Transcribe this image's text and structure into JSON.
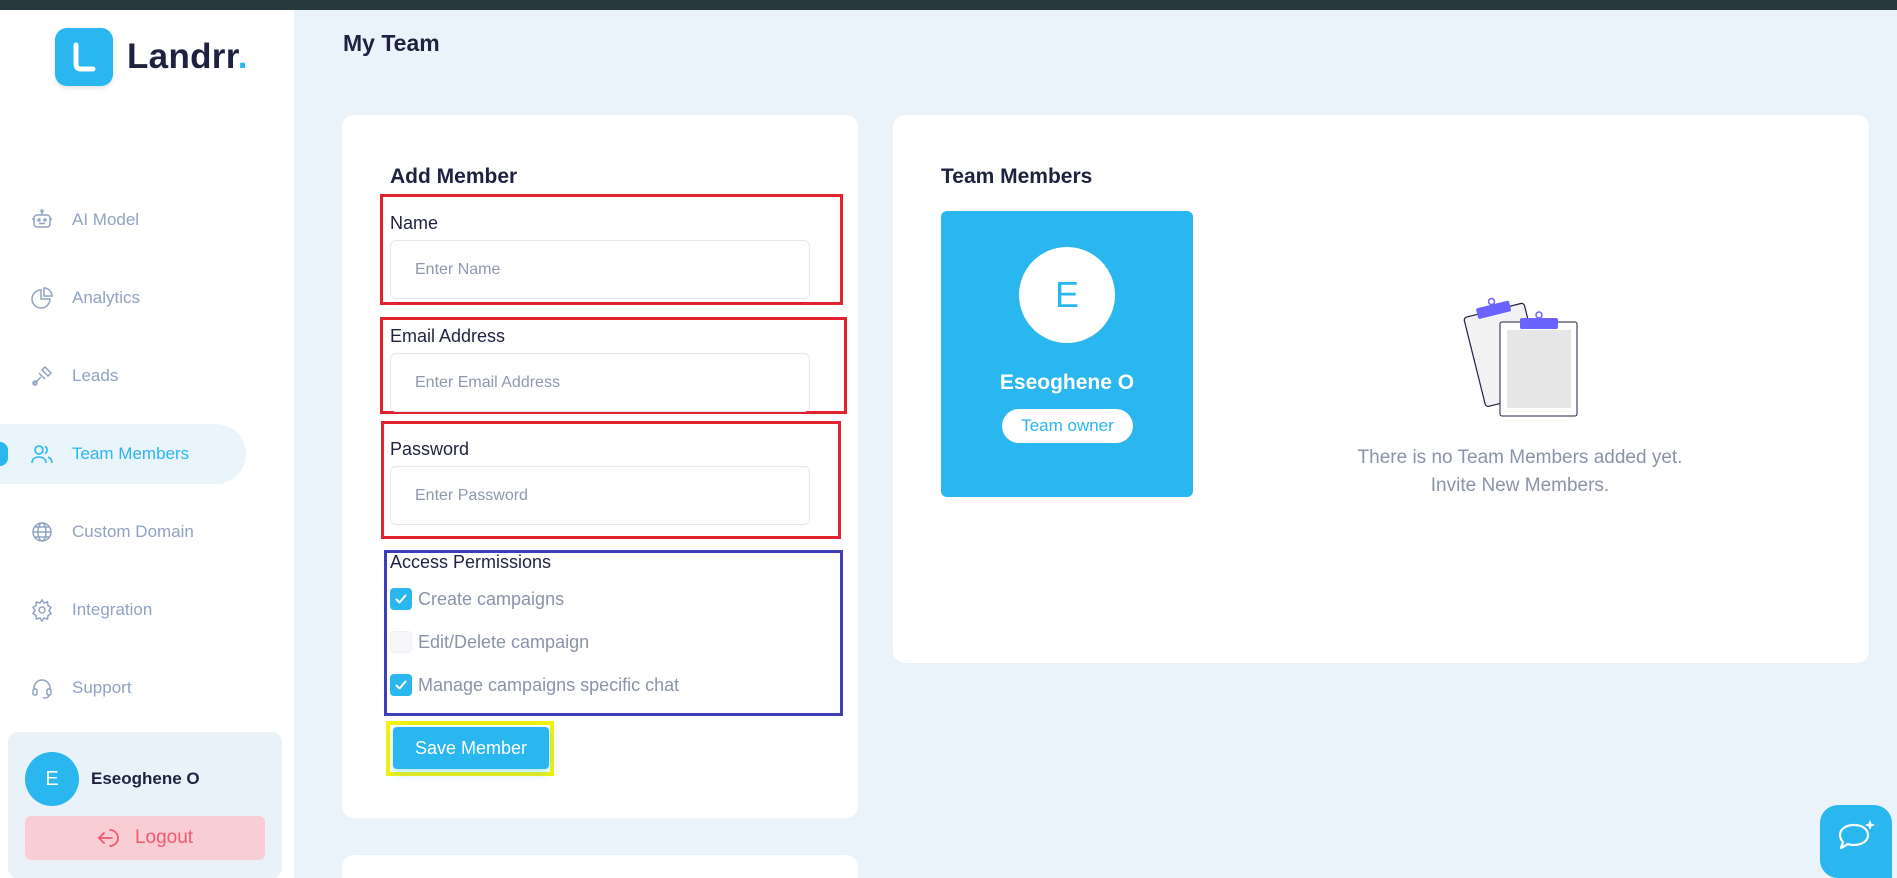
{
  "app": {
    "logo_text": "Landrr",
    "logo_dot": "."
  },
  "sidebar": {
    "items": [
      {
        "label": "AI Model",
        "icon": "robot-icon"
      },
      {
        "label": "Analytics",
        "icon": "pie-chart-icon"
      },
      {
        "label": "Leads",
        "icon": "leads-icon"
      },
      {
        "label": "Team Members",
        "icon": "users-icon",
        "active": true
      },
      {
        "label": "Custom Domain",
        "icon": "globe-icon"
      },
      {
        "label": "Integration",
        "icon": "gear-icon"
      },
      {
        "label": "Support",
        "icon": "headset-icon"
      }
    ],
    "user": {
      "initial": "E",
      "name": "Eseoghene O"
    },
    "logout_label": "Logout"
  },
  "page": {
    "title": "My Team"
  },
  "add_member": {
    "title": "Add Member",
    "name": {
      "label": "Name",
      "placeholder": "Enter Name",
      "value": ""
    },
    "email": {
      "label": "Email Address",
      "placeholder": "Enter Email Address",
      "value": ""
    },
    "password": {
      "label": "Password",
      "placeholder": "Enter Password",
      "value": ""
    },
    "permissions": {
      "title": "Access Permissions",
      "items": [
        {
          "label": "Create campaigns",
          "checked": true
        },
        {
          "label": "Edit/Delete campaign",
          "checked": false
        },
        {
          "label": "Manage campaigns specific chat",
          "checked": true
        }
      ]
    },
    "save_label": "Save Member"
  },
  "team_members": {
    "title": "Team Members",
    "members": [
      {
        "initial": "E",
        "name": "Eseoghene O",
        "role": "Team owner"
      }
    ],
    "empty_line1": "There is no Team Members added yet.",
    "empty_line2": "Invite New Members."
  },
  "colors": {
    "accent": "#2ab6ef",
    "logout_bg": "#f8cdd3",
    "logout_text": "#ef5a6f",
    "highlight_red": "#e0232f",
    "highlight_blue": "#3d3eb8",
    "highlight_yellow": "#f5f20b"
  }
}
